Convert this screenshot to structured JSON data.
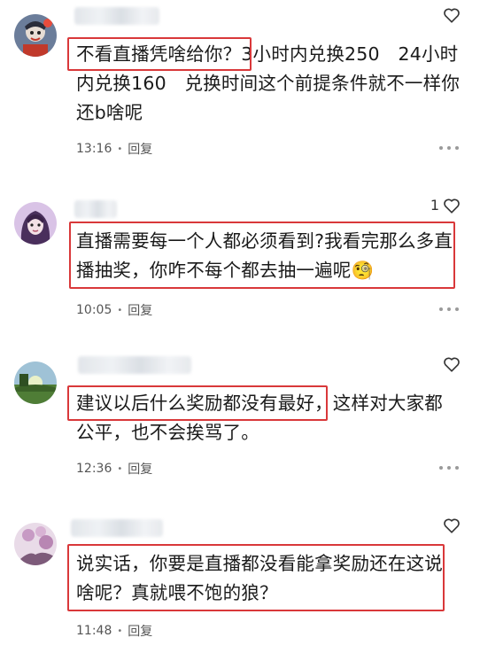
{
  "comments": [
    {
      "text": "不看直播凭啥给你？3小时内兑换250　24小时内兑换160　兑换时间这个前提条件就不一样你还b啥呢",
      "time": "13:16",
      "separator": "•",
      "reply_label": "回复",
      "likes": ""
    },
    {
      "text": "直播需要每一个人都必须看到?我看完那么多直播抽奖，你咋不每个都去抽一遍呢🧐",
      "time": "10:05",
      "separator": "•",
      "reply_label": "回复",
      "likes": "1"
    },
    {
      "text": "建议以后什么奖励都没有最好，这样对大家都公平，也不会挨骂了。",
      "time": "12:36",
      "separator": "•",
      "reply_label": "回复",
      "likes": ""
    },
    {
      "text": "说实话，你要是直播都没看能拿奖励还在这说啥呢？真就喂不饱的狼？",
      "time": "11:48",
      "separator": "•",
      "reply_label": "回复",
      "likes": ""
    }
  ],
  "icons": {
    "like": "heart-outline-icon",
    "more": "more-dots-icon"
  },
  "colors": {
    "highlight_box": "#d9383a",
    "text": "#1a1a1a",
    "meta": "#555555"
  }
}
